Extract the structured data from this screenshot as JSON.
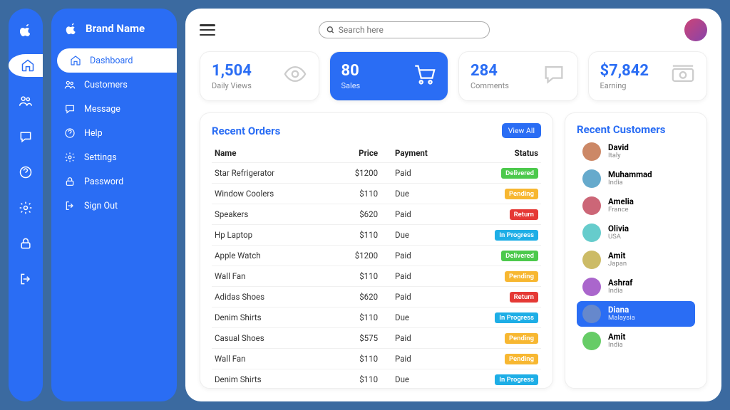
{
  "brand": "Brand Name",
  "search_placeholder": "Search here",
  "sidebar": [
    {
      "icon": "home",
      "label": "Dashboard",
      "active": true
    },
    {
      "icon": "users",
      "label": "Customers"
    },
    {
      "icon": "chat",
      "label": "Message"
    },
    {
      "icon": "help",
      "label": "Help"
    },
    {
      "icon": "gear",
      "label": "Settings"
    },
    {
      "icon": "lock",
      "label": "Password"
    },
    {
      "icon": "signout",
      "label": "Sign Out"
    }
  ],
  "cards": [
    {
      "value": "1,504",
      "label": "Daily Views",
      "icon": "eye"
    },
    {
      "value": "80",
      "label": "Sales",
      "icon": "cart",
      "active": true
    },
    {
      "value": "284",
      "label": "Comments",
      "icon": "chat"
    },
    {
      "value": "$7,842",
      "label": "Earning",
      "icon": "cash"
    }
  ],
  "orders_title": "Recent Orders",
  "viewall": "View All",
  "cols": [
    "Name",
    "Price",
    "Payment",
    "Status"
  ],
  "rows": [
    {
      "name": "Star Refrigerator",
      "price": "$1200",
      "pay": "Paid",
      "status": "Delivered",
      "cls": "delivered"
    },
    {
      "name": "Window Coolers",
      "price": "$110",
      "pay": "Due",
      "status": "Pending",
      "cls": "pending"
    },
    {
      "name": "Speakers",
      "price": "$620",
      "pay": "Paid",
      "status": "Return",
      "cls": "return"
    },
    {
      "name": "Hp Laptop",
      "price": "$110",
      "pay": "Due",
      "status": "In Progress",
      "cls": "progress"
    },
    {
      "name": "Apple Watch",
      "price": "$1200",
      "pay": "Paid",
      "status": "Delivered",
      "cls": "delivered"
    },
    {
      "name": "Wall Fan",
      "price": "$110",
      "pay": "Paid",
      "status": "Pending",
      "cls": "pending"
    },
    {
      "name": "Adidas Shoes",
      "price": "$620",
      "pay": "Paid",
      "status": "Return",
      "cls": "return"
    },
    {
      "name": "Denim Shirts",
      "price": "$110",
      "pay": "Due",
      "status": "In Progress",
      "cls": "progress"
    },
    {
      "name": "Casual Shoes",
      "price": "$575",
      "pay": "Paid",
      "status": "Pending",
      "cls": "pending"
    },
    {
      "name": "Wall Fan",
      "price": "$110",
      "pay": "Paid",
      "status": "Pending",
      "cls": "pending"
    },
    {
      "name": "Denim Shirts",
      "price": "$110",
      "pay": "Due",
      "status": "In Progress",
      "cls": "progress"
    }
  ],
  "cust_title": "Recent Customers",
  "customers": [
    {
      "name": "David",
      "loc": "Italy",
      "hue": 20
    },
    {
      "name": "Muhammad",
      "loc": "India",
      "hue": 200
    },
    {
      "name": "Amelia",
      "loc": "France",
      "hue": 350
    },
    {
      "name": "Olivia",
      "loc": "USA",
      "hue": 180
    },
    {
      "name": "Amit",
      "loc": "Japan",
      "hue": 50
    },
    {
      "name": "Ashraf",
      "loc": "India",
      "hue": 280
    },
    {
      "name": "Diana",
      "loc": "Malaysia",
      "hue": 220,
      "active": true
    },
    {
      "name": "Amit",
      "loc": "India",
      "hue": 120
    }
  ]
}
